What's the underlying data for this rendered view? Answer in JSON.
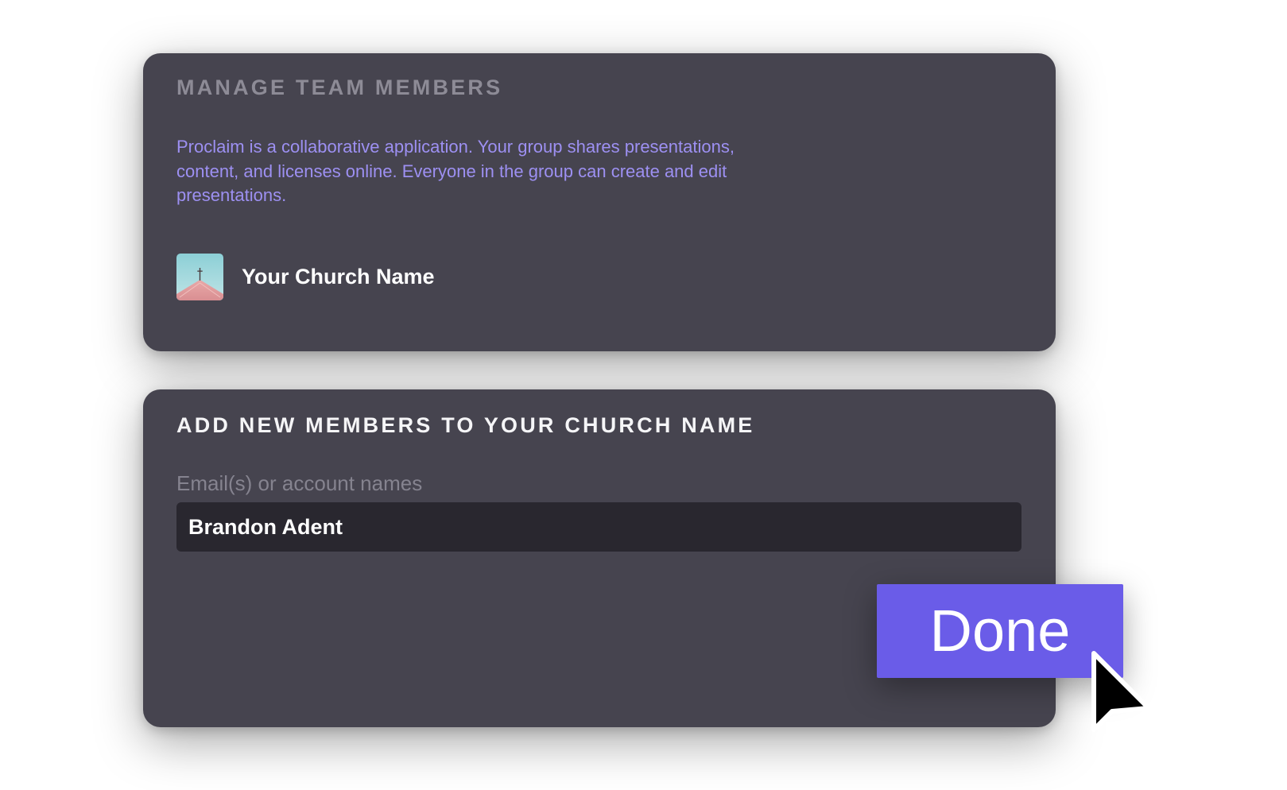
{
  "manage_panel": {
    "title": "MANAGE TEAM MEMBERS",
    "description": "Proclaim is a collaborative application. Your group shares presentations, content, and licenses online. Everyone in the group can create and edit presentations.",
    "church": {
      "avatar_icon": "church-steeple-icon",
      "name": "Your Church Name"
    }
  },
  "add_panel": {
    "title": "ADD NEW MEMBERS TO YOUR CHURCH NAME",
    "field_label": "Email(s) or account names",
    "field_value": "Brandon Adent"
  },
  "actions": {
    "done_label": "Done"
  },
  "cursor_icon": "arrow-pointer-icon",
  "colors": {
    "panel_background": "#46444f",
    "accent": "#6a5ce8",
    "description_text": "#9d90f2",
    "input_background": "#29272f"
  }
}
